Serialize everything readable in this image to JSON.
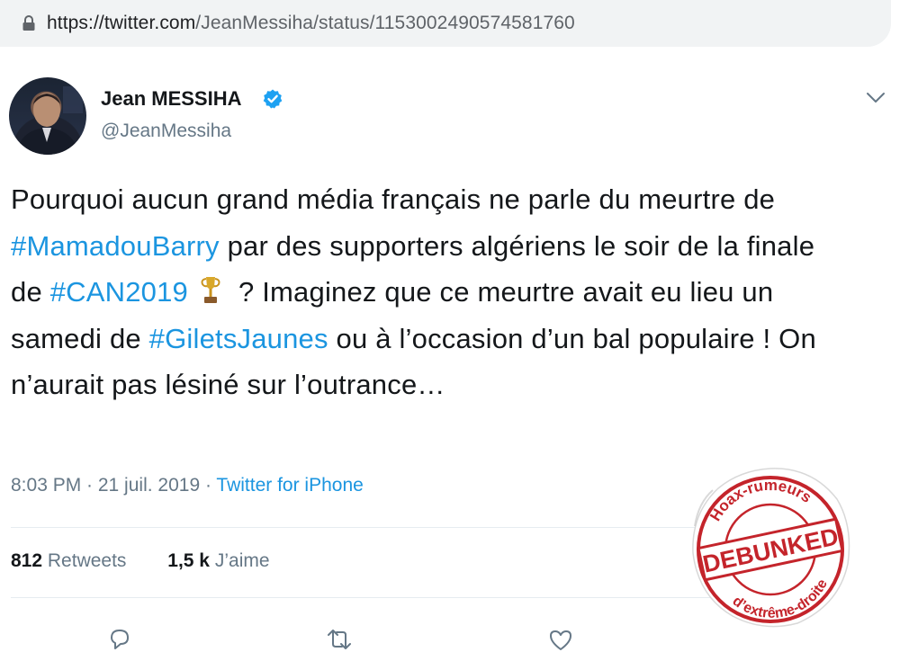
{
  "browser": {
    "url_domain": "https://twitter.com",
    "url_path": "/JeanMessiha/status/1153002490574581760"
  },
  "tweet": {
    "author_name": "Jean MESSIHA",
    "author_handle": "@JeanMessiha",
    "text": {
      "p1": "Pourquoi aucun grand média français ne parle du meurtre de ",
      "h1": "#MamadouBarry",
      "p2": " par des supporters algériens le soir de la finale de ",
      "h2": "#CAN2019",
      "p3": "? Imaginez que ce meurtre avait eu lieu un samedi de ",
      "h3": "#GiletsJaunes",
      "p4": " ou à l’occasion d’un bal populaire ! On n’aurait pas lésiné sur l’outrance…"
    },
    "timestamp": "8:03 PM · 21 juil. 2019 · ",
    "source": "Twitter for iPhone",
    "retweets_count": "812",
    "retweets_label": "Retweets",
    "likes_count": "1,5 k",
    "likes_label": "J’aime"
  },
  "stamp": {
    "top_text": "Hoax-rumeurs",
    "center_text": "DEBUNKED",
    "bottom_text": "d’extrême-droite",
    "color": "#c4242b"
  },
  "colors": {
    "link": "#1b95e0",
    "secondary": "#657786",
    "primary_text": "#14171a"
  },
  "icons": [
    "lock-icon",
    "verified-badge-icon",
    "chevron-down-icon",
    "trophy-emoji-icon",
    "reply-icon",
    "retweet-icon",
    "like-icon"
  ]
}
